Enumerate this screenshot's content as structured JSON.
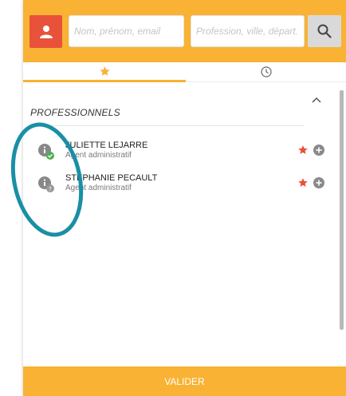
{
  "search": {
    "name_placeholder": "Nom, prénom, email",
    "profession_placeholder": "Profession, ville, départ."
  },
  "tabs": [
    {
      "icon": "star-icon",
      "active": true
    },
    {
      "icon": "clock-icon",
      "active": false
    }
  ],
  "section": {
    "title": "PROFESSIONNELS"
  },
  "professionals": [
    {
      "name": "JULIETTE LEJARRE",
      "role": "Agent administratif",
      "status": "green-check",
      "favorite": true
    },
    {
      "name": "STEPHANIE PECAULT",
      "role": "Agent administratif",
      "status": "gray-question",
      "favorite": true
    }
  ],
  "footer": {
    "validate_label": "VALIDER"
  },
  "colors": {
    "accent": "#f9b233",
    "user_button": "#e8523a",
    "favorite_star": "#e8523a",
    "annotation_circle": "#1a8fa5"
  }
}
